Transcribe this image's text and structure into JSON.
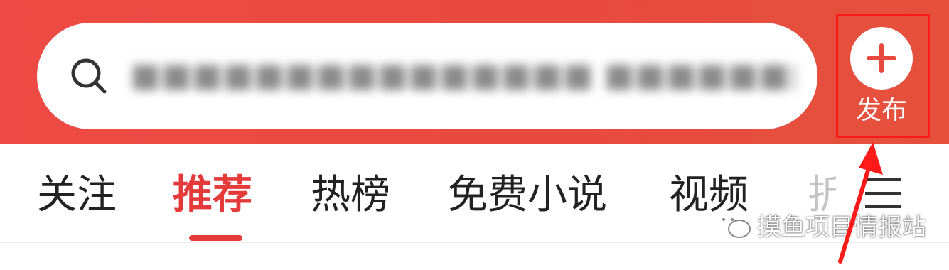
{
  "search": {
    "query_blurred": "■■■■■■■■■■■■■■■ ■■■■■■■■■ 7"
  },
  "publish": {
    "label": "发布",
    "icon": "plus-icon"
  },
  "tabs": [
    {
      "label": "关注"
    },
    {
      "label": "推荐",
      "active": true
    },
    {
      "label": "热榜"
    },
    {
      "label": "免费小说"
    },
    {
      "label": "视频"
    },
    {
      "label": "折"
    }
  ],
  "watermark": {
    "text": "摸鱼项目情报站",
    "icon": "wechat-icon"
  },
  "colors": {
    "header_red": "#ea4b42",
    "active_tab": "#e53a3a",
    "annotation": "#ff1a1a"
  }
}
